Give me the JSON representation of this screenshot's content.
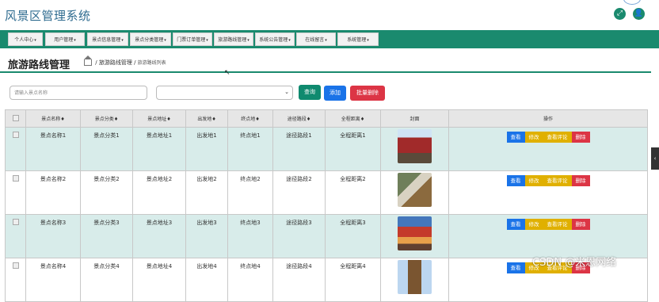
{
  "app": {
    "title": "风景区管理系统"
  },
  "nav": {
    "items": [
      {
        "label": "个人中心"
      },
      {
        "label": "用户管理"
      },
      {
        "label": "景点信息管理"
      },
      {
        "label": "景点分类管理"
      },
      {
        "label": "门票订单管理"
      },
      {
        "label": "旅游路线管理"
      },
      {
        "label": "系统公告管理"
      },
      {
        "label": "在线留言"
      },
      {
        "label": "系统管理"
      }
    ],
    "caret": "▾"
  },
  "page": {
    "title": "旅游路线管理",
    "breadcrumb": {
      "sep": "/",
      "parent": "旅游路线管理",
      "current": "旅游路线列表"
    }
  },
  "search": {
    "placeholder": "请输入景点名称",
    "select_value": "",
    "query_label": "查询",
    "add_label": "添加",
    "batch_delete_label": "批量删除"
  },
  "table": {
    "headers": [
      "景点名称",
      "景点分类",
      "景点地址",
      "出发地",
      "终点地",
      "途径路段",
      "全程距离",
      "封面",
      "操作"
    ],
    "sort_mark": "♦",
    "rows": [
      {
        "name": "景点名称1",
        "category": "景点分类1",
        "address": "景点地址1",
        "start": "出发地1",
        "end": "终点地1",
        "route": "途径路段1",
        "distance": "全程距离1"
      },
      {
        "name": "景点名称2",
        "category": "景点分类2",
        "address": "景点地址2",
        "start": "出发地2",
        "end": "终点地2",
        "route": "途径路段2",
        "distance": "全程距离2"
      },
      {
        "name": "景点名称3",
        "category": "景点分类3",
        "address": "景点地址3",
        "start": "出发地3",
        "end": "终点地3",
        "route": "途径路段3",
        "distance": "全程距离3"
      },
      {
        "name": "景点名称4",
        "category": "景点分类4",
        "address": "景点地址4",
        "start": "出发地4",
        "end": "终点地4",
        "route": "途径路段4",
        "distance": "全程距离4"
      }
    ],
    "actions": {
      "view": "查看",
      "edit": "修改",
      "comments": "查看评论",
      "delete": "删除"
    }
  },
  "side_tab": {
    "label": "‹"
  },
  "watermark": "CSDN @米恩网络",
  "colors": {
    "primary": "#1a8a6e",
    "blue": "#1a73e8",
    "yellow": "#e0b000",
    "red": "#dc3545",
    "row_shade": "#d8ecea"
  }
}
